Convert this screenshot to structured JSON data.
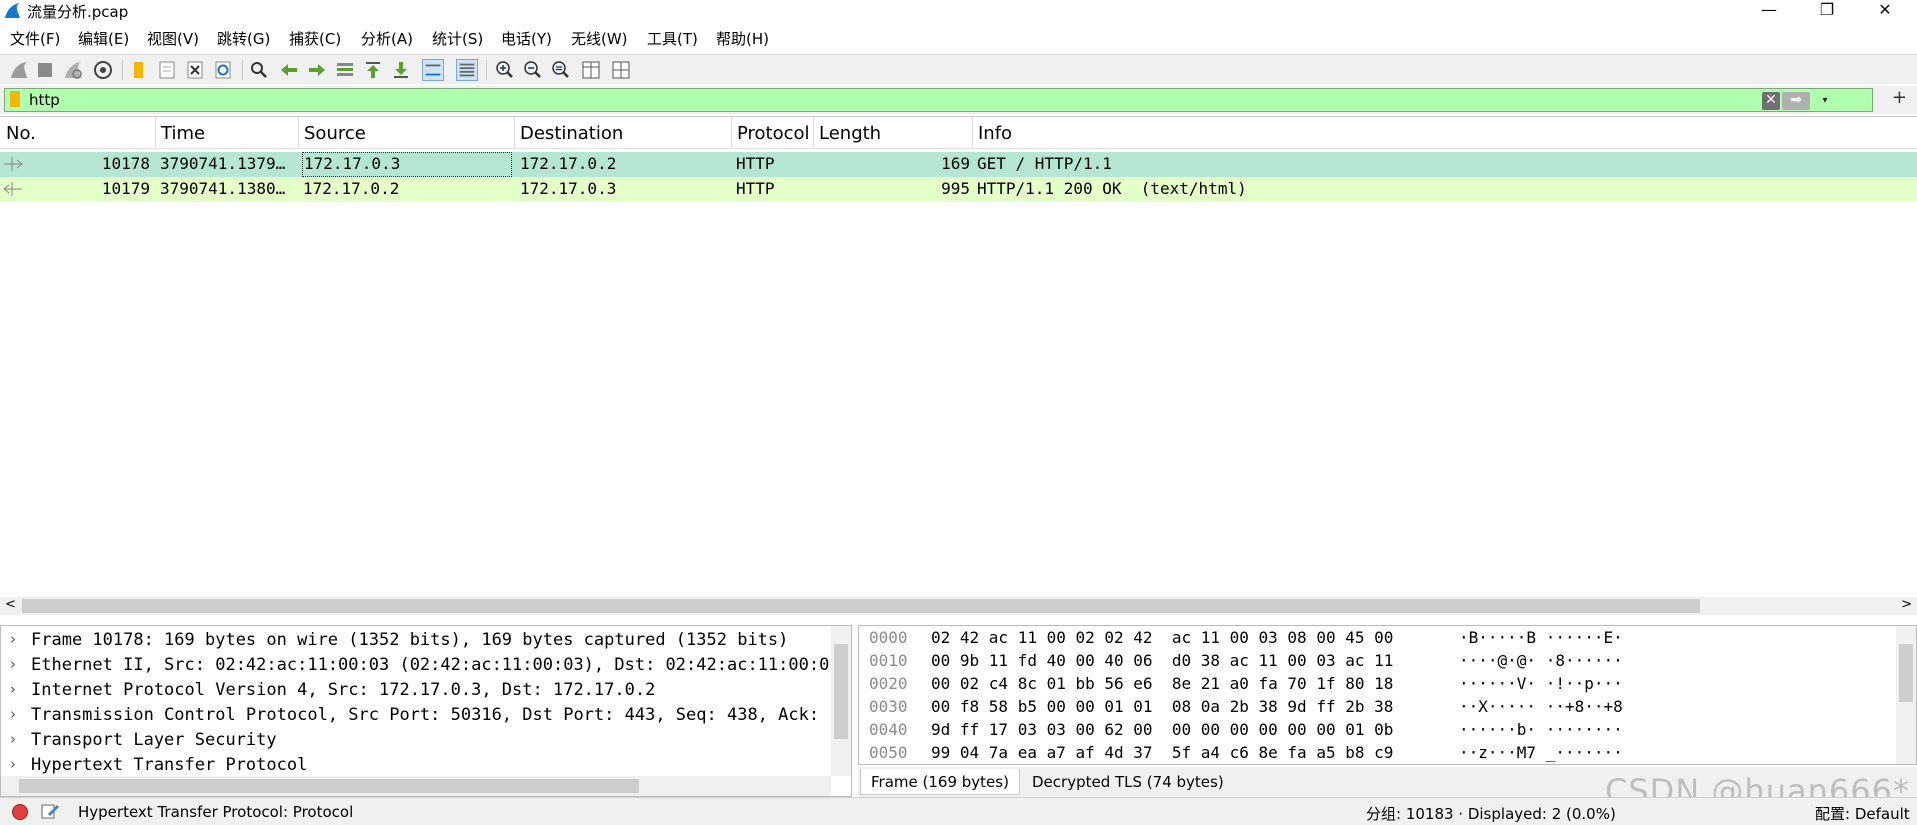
{
  "window": {
    "title": "流量分析.pcap",
    "minimize": "—",
    "restore": "❐",
    "close": "✕"
  },
  "menu": [
    "文件(F)",
    "编辑(E)",
    "视图(V)",
    "跳转(G)",
    "捕获(C)",
    "分析(A)",
    "统计(S)",
    "电话(Y)",
    "无线(W)",
    "工具(T)",
    "帮助(H)"
  ],
  "filter": {
    "value": "http",
    "clear_glyph": "✕",
    "apply_glyph": "➡",
    "dropdown_glyph": "▾",
    "add_glyph": "+"
  },
  "packet_list": {
    "columns": [
      "No.",
      "Time",
      "Source",
      "Destination",
      "Protocol",
      "Length",
      "Info"
    ],
    "rows": [
      {
        "no": "10178",
        "time": "3790741.1379…",
        "source": "172.17.0.3",
        "destination": "172.17.0.2",
        "protocol": "HTTP",
        "length": "169",
        "info": "GET / HTTP/1.1",
        "color": "#b5e6d2"
      },
      {
        "no": "10179",
        "time": "3790741.1380…",
        "source": "172.17.0.2",
        "destination": "172.17.0.3",
        "protocol": "HTTP",
        "length": "995",
        "info": "HTTP/1.1 200 OK  (text/html)",
        "color": "#e4ffc7"
      }
    ]
  },
  "details": [
    "Frame 10178: 169 bytes on wire (1352 bits), 169 bytes captured (1352 bits)",
    "Ethernet II, Src: 02:42:ac:11:00:03 (02:42:ac:11:00:03), Dst: 02:42:ac:11:00:0",
    "Internet Protocol Version 4, Src: 172.17.0.3, Dst: 172.17.0.2",
    "Transmission Control Protocol, Src Port: 50316, Dst Port: 443, Seq: 438, Ack:",
    "Transport Layer Security",
    "Hypertext Transfer Protocol"
  ],
  "bytes": [
    {
      "offset": "0000",
      "hex": "02 42 ac 11 00 02 02 42  ac 11 00 03 08 00 45 00",
      "ascii": "·B·····B ······E·"
    },
    {
      "offset": "0010",
      "hex": "00 9b 11 fd 40 00 40 06  d0 38 ac 11 00 03 ac 11",
      "ascii": "····@·@· ·8······"
    },
    {
      "offset": "0020",
      "hex": "00 02 c4 8c 01 bb 56 e6  8e 21 a0 fa 70 1f 80 18",
      "ascii": "······V· ·!··p···"
    },
    {
      "offset": "0030",
      "hex": "00 f8 58 b5 00 00 01 01  08 0a 2b 38 9d ff 2b 38",
      "ascii": "··X····· ··+8··+8"
    },
    {
      "offset": "0040",
      "hex": "9d ff 17 03 03 00 62 00  00 00 00 00 00 00 01 0b",
      "ascii": "······b· ········"
    },
    {
      "offset": "0050",
      "hex": "99 04 7a ea a7 af 4d 37  5f a4 c6 8e fa a5 b8 c9",
      "ascii": "··z···M7 _·······"
    }
  ],
  "bytes_tabs": [
    "Frame (169 bytes)",
    "Decrypted TLS (74 bytes)"
  ],
  "status": {
    "field": "Hypertext Transfer Protocol: Protocol",
    "packets": "分组: 10183 · Displayed: 2 (0.0%)",
    "profile": "配置: Default"
  },
  "watermark": "CSDN @huan666*"
}
